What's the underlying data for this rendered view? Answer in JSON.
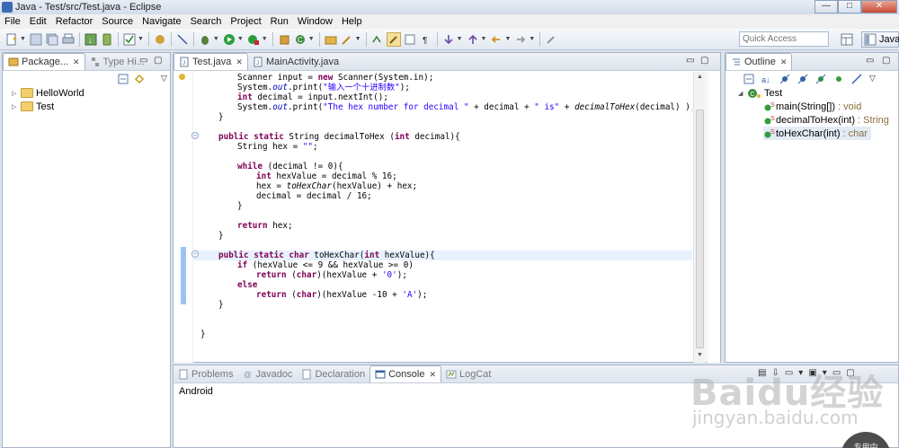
{
  "window": {
    "title": "Java - Test/src/Test.java - Eclipse",
    "minimize": "—",
    "maximize": "□",
    "close": "✕"
  },
  "menu": [
    "File",
    "Edit",
    "Refactor",
    "Source",
    "Navigate",
    "Search",
    "Project",
    "Run",
    "Window",
    "Help"
  ],
  "toolbar": {
    "quick_access_placeholder": "Quick Access",
    "perspective_label": "Java"
  },
  "package_explorer": {
    "tabs": [
      "Package...",
      "Type Hi..."
    ],
    "projects": [
      "HelloWorld",
      "Test"
    ]
  },
  "editor": {
    "tabs": [
      "Test.java",
      "MainActivity.java"
    ],
    "code": [
      "Scanner input = new Scanner(System.in);",
      "System.out.print(\"输入一个十进制数\");",
      "int decimal = input.nextInt();",
      "System.out.print(\"The hex number for decimal \" + decimal + \" is\" + decimalToHex(decimal) );",
      "}",
      "",
      "public static String decimalToHex (int decimal){",
      "String hex = \"\";",
      "",
      "while (decimal != 0){",
      "int hexValue = decimal % 16;",
      "hex = toHexChar(hexValue) + hex;",
      "decimal = decimal / 16;",
      "}",
      "",
      "return hex;",
      "}",
      "",
      "public static char toHexChar(int hexValue){",
      "if (hexValue <= 9 && hexValue >= 0)",
      "return (char)(hexValue + '0');",
      "else",
      "return (char)(hexValue -10 + 'A');",
      "}",
      "",
      "",
      "}"
    ]
  },
  "outline": {
    "tab": "Outline",
    "class_name": "Test",
    "members": [
      {
        "name": "main(String[])",
        "type": "void"
      },
      {
        "name": "decimalToHex(int)",
        "type": "String"
      },
      {
        "name": "toHexChar(int)",
        "type": "char"
      }
    ]
  },
  "console": {
    "tabs": [
      "Problems",
      "Javadoc",
      "Declaration",
      "Console",
      "LogCat"
    ],
    "output": "Android"
  },
  "watermark": {
    "brand": "Baidu经验",
    "url": "jingyan.baidu.com",
    "badge": "专用中"
  },
  "colors": {
    "keyword": "#7f0055",
    "string": "#2a00ff",
    "field": "#0000c0",
    "selection": "#e8f2fe"
  }
}
